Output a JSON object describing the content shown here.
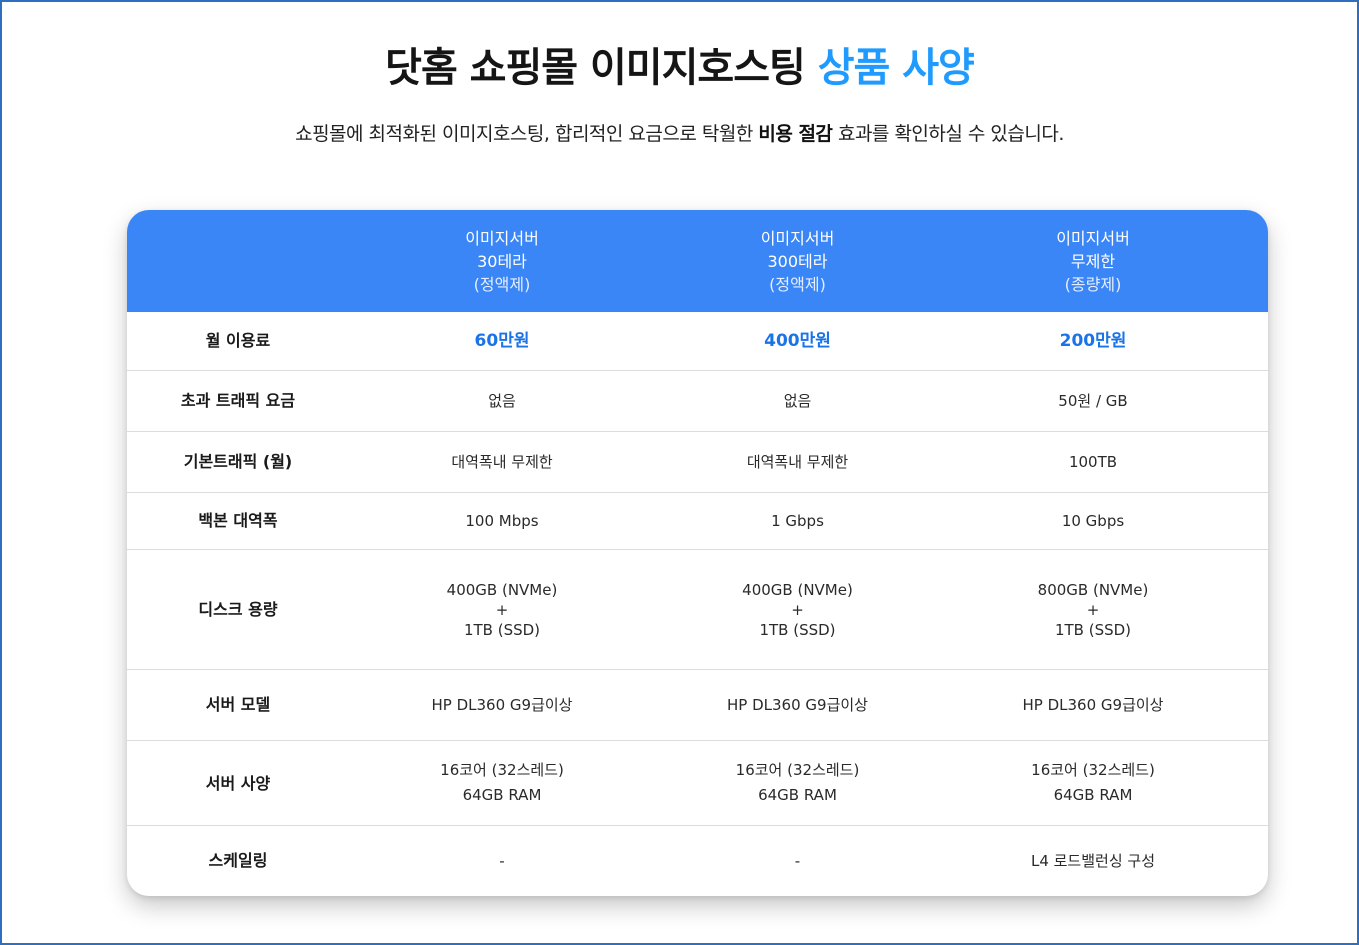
{
  "header": {
    "title_main": "닷홈 쇼핑몰 이미지호스팅 ",
    "title_accent": "상품 사양",
    "subtitle_pre": "쇼핑몰에 최적화된 이미지호스팅, 합리적인 요금으로 탁월한 ",
    "subtitle_bold": "비용 절감",
    "subtitle_post": " 효과를 확인하실 수 있습니다."
  },
  "colors": {
    "accent": "#1f9bff",
    "table_header": "#3a86f7",
    "price": "#1a73e8"
  },
  "table": {
    "columns": [
      {
        "line1": "이미지서버",
        "line2": "30테라",
        "line3": "(정액제)"
      },
      {
        "line1": "이미지서버",
        "line2": "300테라",
        "line3": "(정액제)"
      },
      {
        "line1": "이미지서버",
        "line2": "무제한",
        "line3": "(종량제)"
      }
    ],
    "rows": [
      {
        "label": "월 이용료",
        "values": [
          "60만원",
          "400만원",
          "200만원"
        ]
      },
      {
        "label": "초과 트래픽 요금",
        "values": [
          "없음",
          "없음",
          "50원 / GB"
        ]
      },
      {
        "label": "기본트래픽 (월)",
        "values": [
          "대역폭내 무제한",
          "대역폭내 무제한",
          "100TB"
        ]
      },
      {
        "label": "백본 대역폭",
        "values": [
          "100 Mbps",
          "1 Gbps",
          "10 Gbps"
        ]
      },
      {
        "label": "디스크 용량",
        "values": [
          {
            "a": "400GB (NVMe)",
            "plus": "+",
            "b": "1TB (SSD)"
          },
          {
            "a": "400GB (NVMe)",
            "plus": "+",
            "b": "1TB (SSD)"
          },
          {
            "a": "800GB (NVMe)",
            "plus": "+",
            "b": "1TB (SSD)"
          }
        ]
      },
      {
        "label": "서버 모델",
        "values": [
          "HP DL360 G9급이상",
          "HP DL360 G9급이상",
          "HP DL360 G9급이상"
        ]
      },
      {
        "label": "서버 사양",
        "values": [
          {
            "a": "16코어 (32스레드)",
            "b": "64GB RAM"
          },
          {
            "a": "16코어 (32스레드)",
            "b": "64GB RAM"
          },
          {
            "a": "16코어 (32스레드)",
            "b": "64GB RAM"
          }
        ]
      },
      {
        "label": "스케일링",
        "values": [
          "-",
          "-",
          "L4 로드밸런싱 구성"
        ]
      }
    ]
  }
}
